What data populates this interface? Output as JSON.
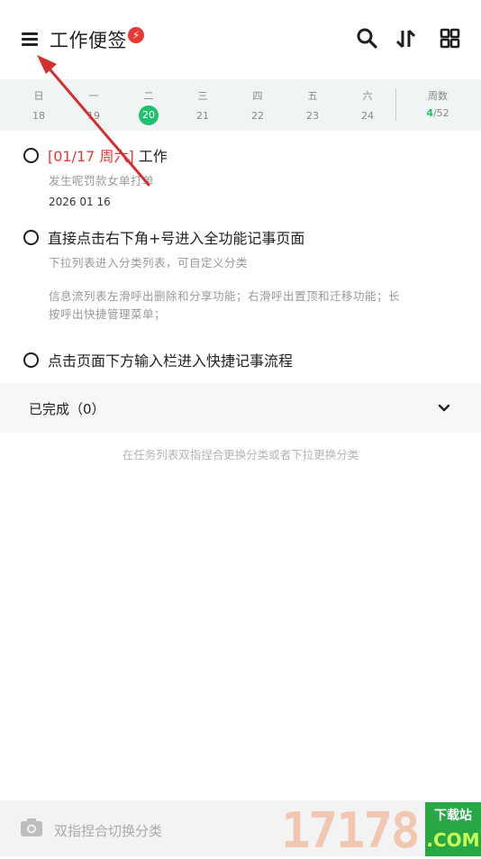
{
  "header": {
    "title": "工作便签",
    "badge": "⚡",
    "icons": [
      "menu-icon",
      "search-icon",
      "sort-icon",
      "grid-view-icon"
    ]
  },
  "week": {
    "days": [
      {
        "name": "日",
        "num": "18"
      },
      {
        "name": "一",
        "num": "19"
      },
      {
        "name": "二",
        "num": "20",
        "today": true
      },
      {
        "name": "三",
        "num": "21"
      },
      {
        "name": "四",
        "num": "22"
      },
      {
        "name": "五",
        "num": "23"
      },
      {
        "name": "六",
        "num": "24"
      }
    ],
    "week_label": "周数",
    "week_current": "4",
    "week_total": "/52",
    "accent_color": "#1ec16e"
  },
  "tasks": [
    {
      "date_tag": "[01/17 周六]",
      "title": "工作",
      "subtitle": "发生呢罚款女单打单",
      "meta": "2026 01 16"
    },
    {
      "title": "直接点击右下角+号进入全功能记事页面",
      "sub1": "下拉列表进入分类列表，可自定义分类",
      "sub2": "信息流列表左滑呼出删除和分享功能；右滑呼出置顶和迁移功能；长",
      "sub3": "按呼出快捷管理菜单；"
    },
    {
      "title": "点击页面下方输入栏进入快捷记事流程"
    }
  ],
  "completed": {
    "label": "已完成（0）"
  },
  "hint": "在任务列表双指捏合更换分类或者下拉更换分类",
  "bottom": {
    "placeholder": "双指捏合切换分类",
    "fab_label": "+"
  },
  "watermark": {
    "number": "17178",
    "top": "下载站",
    "bottom": ".COM"
  },
  "colors": {
    "date_red": "#e53935",
    "annotation_arrow": "#d32f2f"
  }
}
